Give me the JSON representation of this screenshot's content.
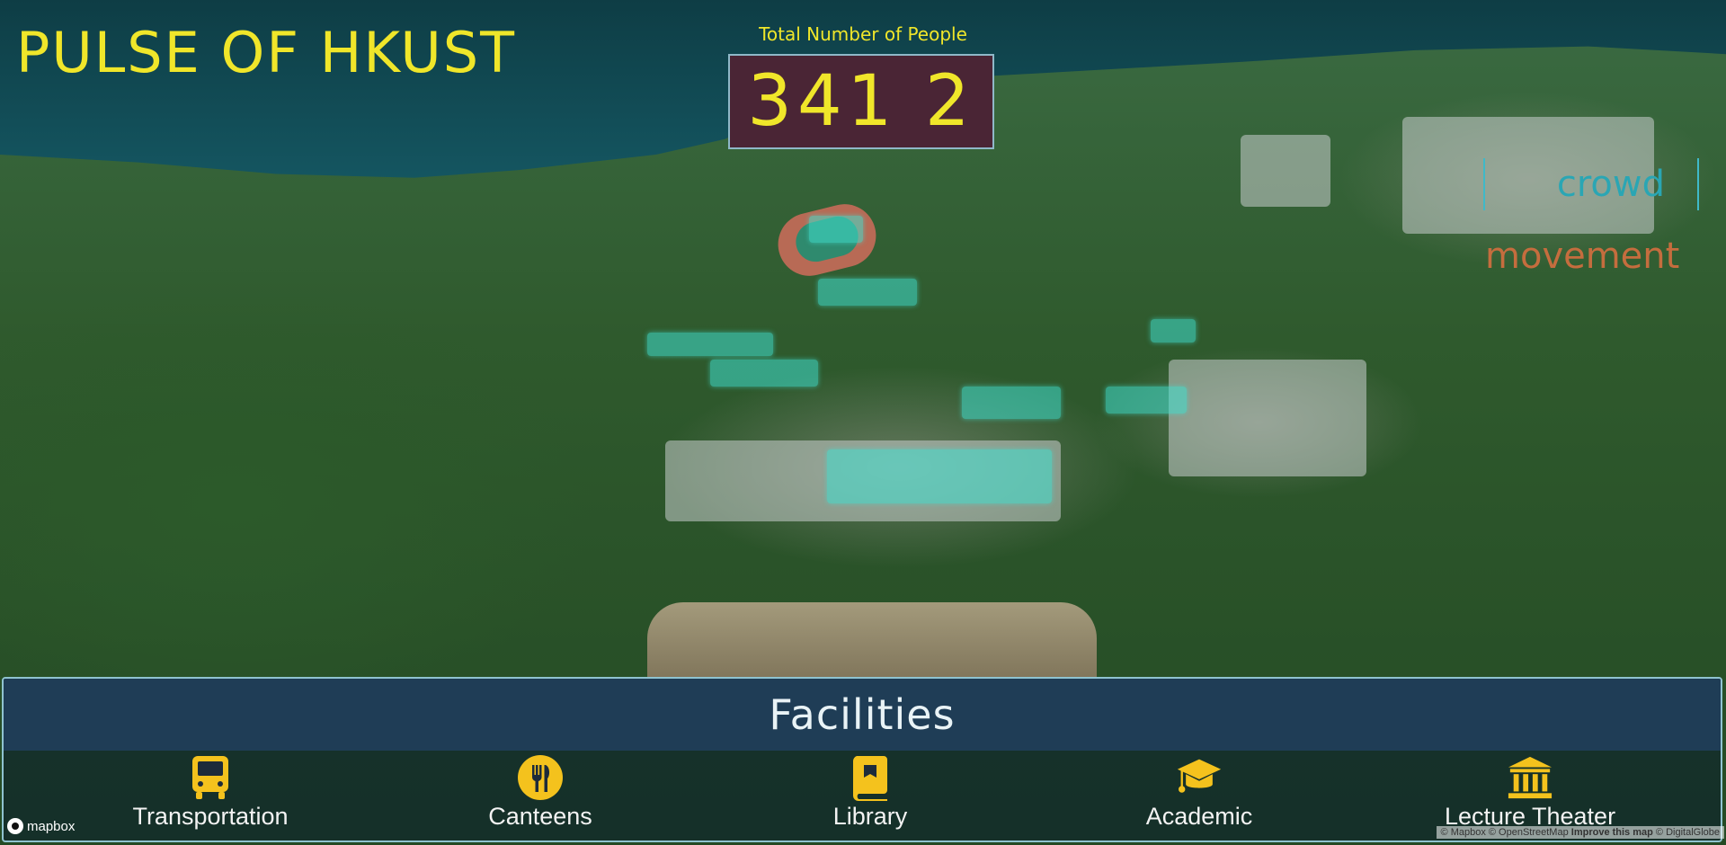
{
  "app": {
    "title": "PULSE OF HKUST"
  },
  "counter": {
    "label": "Total Number of People",
    "value": "341 2"
  },
  "mode_toggle": {
    "crowd_label": "crowd",
    "movement_label": "movement",
    "crowd_color": "#2aa6b4",
    "movement_color": "#c56d3e"
  },
  "facilities": {
    "title": "Facilities",
    "items": [
      {
        "label": "Transportation",
        "icon": "bus-icon"
      },
      {
        "label": "Canteens",
        "icon": "fork-knife-icon"
      },
      {
        "label": "Library",
        "icon": "book-icon"
      },
      {
        "label": "Academic",
        "icon": "graduation-cap-icon"
      },
      {
        "label": "Lecture Theater",
        "icon": "building-columns-icon"
      }
    ]
  },
  "map": {
    "logo_text": "mapbox",
    "attribution_text": "© Mapbox © OpenStreetMap",
    "attribution_link": "Improve this map",
    "attribution_suffix": "© DigitalGlobe"
  },
  "colors": {
    "accent_yellow": "#f0e62a",
    "counter_bg": "#4a2535",
    "panel_header": "#1f3d56",
    "crowd_dots": "#40e0d0"
  }
}
